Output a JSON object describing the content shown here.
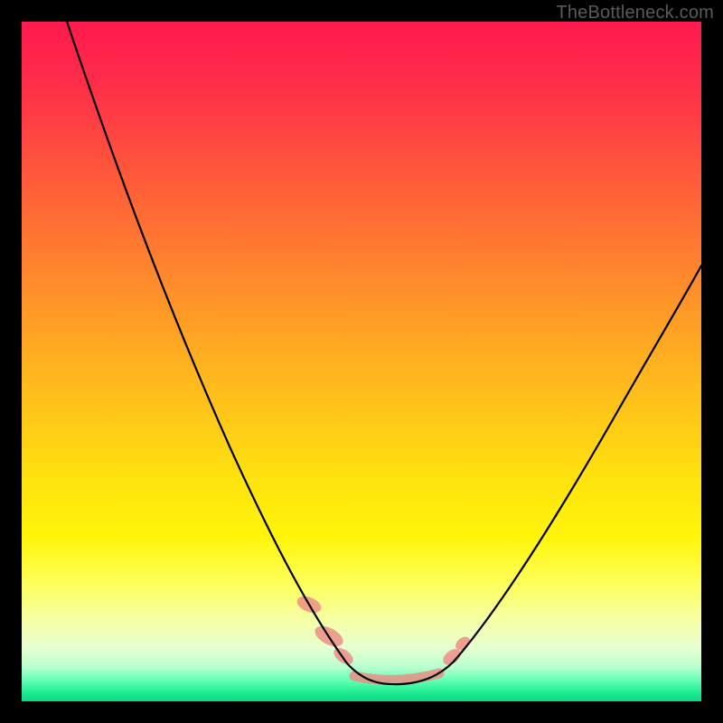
{
  "watermark": "TheBottleneck.com",
  "chart_data": {
    "type": "line",
    "title": "",
    "xlabel": "",
    "ylabel": "",
    "xlim": [
      0,
      100
    ],
    "ylim": [
      0,
      100
    ],
    "grid": false,
    "series": [
      {
        "name": "bottleneck-curve",
        "x": [
          0,
          5,
          10,
          15,
          20,
          25,
          30,
          35,
          40,
          45,
          48,
          50,
          52,
          55,
          58,
          60,
          62,
          65,
          70,
          75,
          80,
          85,
          90,
          95,
          100
        ],
        "y": [
          104,
          94,
          83,
          71,
          60,
          49,
          38,
          28,
          18,
          9,
          4,
          1.5,
          0.5,
          0,
          0,
          0,
          1,
          3.5,
          9,
          16,
          24,
          33,
          42,
          51,
          60
        ]
      }
    ],
    "markers": [
      {
        "name": "left-shoulder-blob-1",
        "x": 42,
        "y": 14
      },
      {
        "name": "left-shoulder-blob-2",
        "x": 45,
        "y": 9
      },
      {
        "name": "right-shoulder-blob",
        "x": 63,
        "y": 5
      },
      {
        "name": "flat-bottom-segment",
        "x_from": 49,
        "x_to": 61,
        "y": 0.5
      }
    ]
  }
}
